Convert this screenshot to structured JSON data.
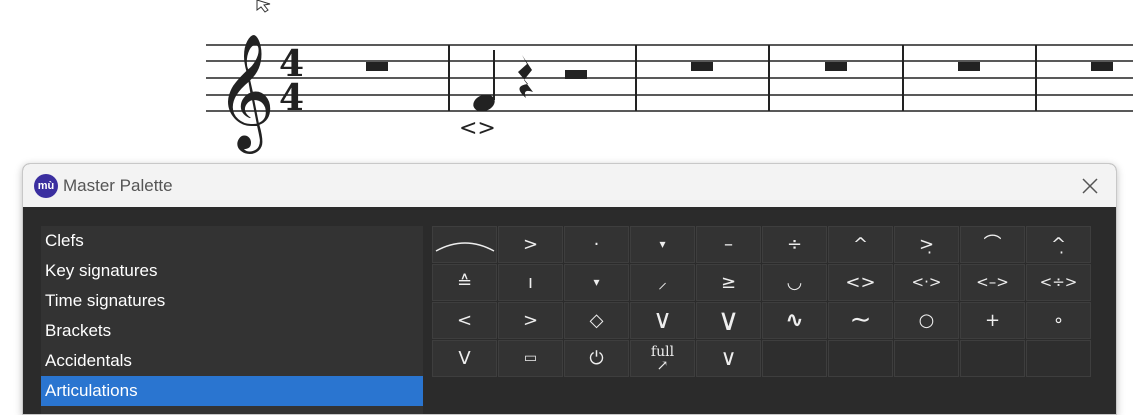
{
  "palette": {
    "title": "Master Palette",
    "logo_text": "mù",
    "categories": [
      {
        "label": "Clefs",
        "selected": false
      },
      {
        "label": "Key signatures",
        "selected": false
      },
      {
        "label": "Time signatures",
        "selected": false
      },
      {
        "label": "Brackets",
        "selected": false
      },
      {
        "label": "Accidentals",
        "selected": false
      },
      {
        "label": "Articulations",
        "selected": true
      }
    ],
    "articulations": [
      [
        "slur-arc",
        ">",
        "·",
        "▾",
        "–",
        "÷",
        "^",
        ">̣",
        "⌒",
        "^̣"
      ],
      [
        "≙",
        "ı",
        "▾",
        "⸝",
        "≥",
        "◡",
        "<>",
        "<·>",
        "<–>",
        "<÷>"
      ],
      [
        "<",
        ">",
        "◇",
        "∨",
        "∨",
        "∿",
        "∼",
        "○",
        "+",
        "∘"
      ],
      [
        "V",
        "▭",
        "⏻",
        "full",
        "∨",
        "",
        "",
        "",
        "",
        ""
      ]
    ],
    "bend_label": "full"
  },
  "score": {
    "time_signature_top": "4",
    "time_signature_bottom": "4",
    "hairpin": "<>"
  },
  "colors": {
    "accent": "#2a75d0",
    "panel": "#2b2b2b",
    "logo": "#3b2fa0"
  }
}
